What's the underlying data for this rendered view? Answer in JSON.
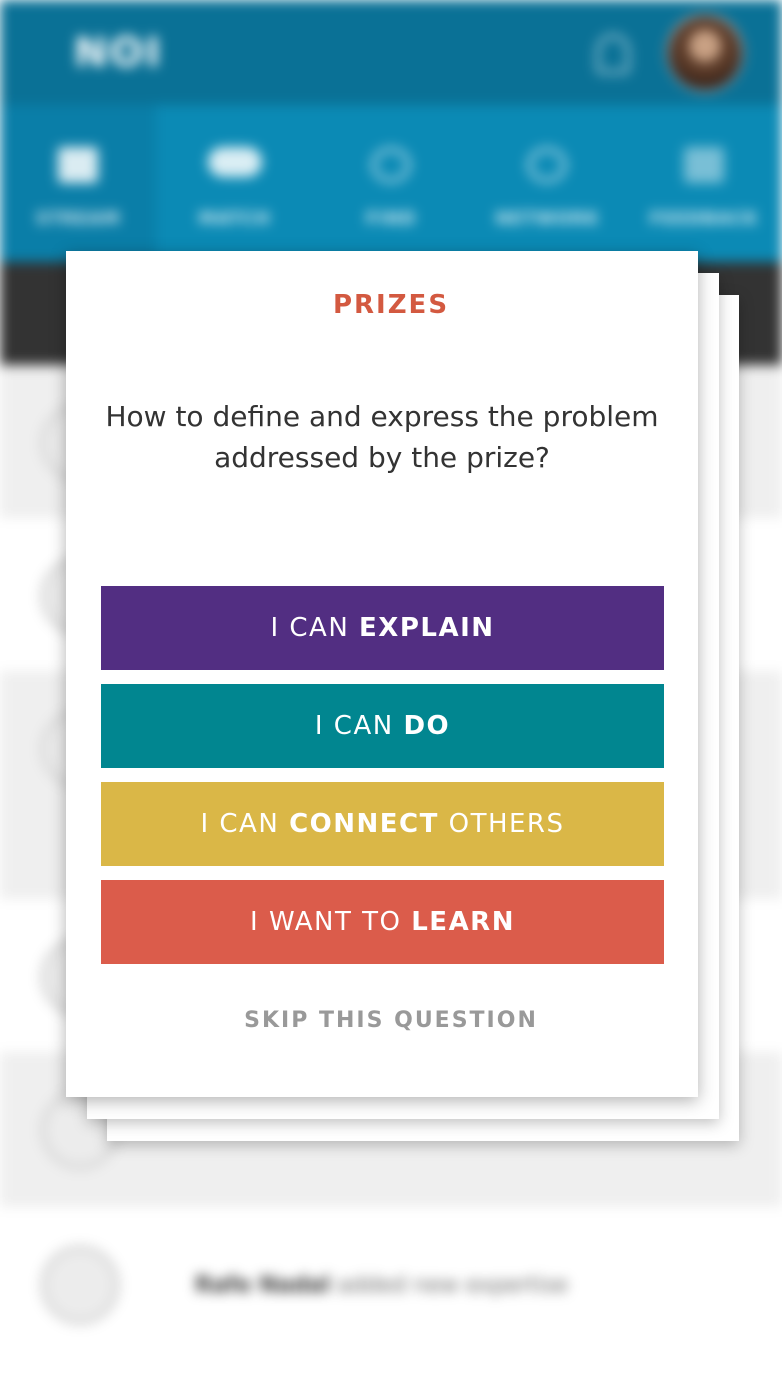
{
  "app": {
    "logo": "NOI",
    "nav": [
      {
        "label": "STREAM"
      },
      {
        "label": "MATCH"
      },
      {
        "label": "FIND"
      },
      {
        "label": "NETWORK"
      },
      {
        "label": "FEEDBACK"
      }
    ],
    "feed_last": {
      "name": "Rafe Nadal",
      "action": "added new expertise"
    }
  },
  "modal": {
    "title": "PRIZES",
    "question": "How to define and express the problem addressed by the prize?",
    "choices": [
      {
        "prefix": "I CAN ",
        "emphasis": "EXPLAIN",
        "suffix": "",
        "color": "#522e82"
      },
      {
        "prefix": "I CAN ",
        "emphasis": "DO",
        "suffix": "",
        "color": "#018690"
      },
      {
        "prefix": "I CAN ",
        "emphasis": "CONNECT",
        "suffix": " OTHERS",
        "color": "#dab747"
      },
      {
        "prefix": "I WANT TO ",
        "emphasis": "LEARN",
        "suffix": "",
        "color": "#db5c4b"
      }
    ],
    "skip_label": "SKIP THIS QUESTION"
  }
}
